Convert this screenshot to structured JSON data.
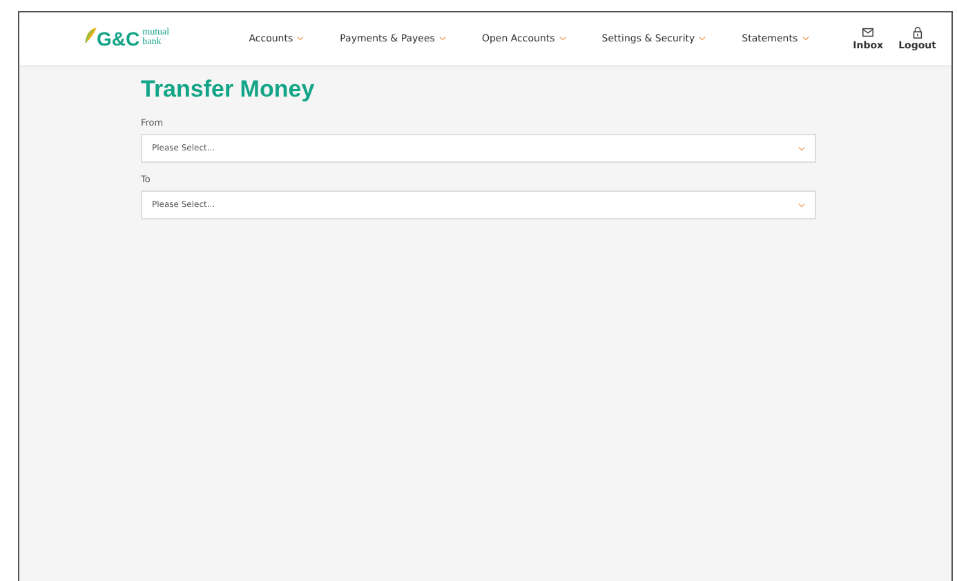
{
  "logo": {
    "mark": "G&C",
    "line_1": "mutual",
    "line_2": "bank"
  },
  "nav": [
    {
      "label": "Accounts"
    },
    {
      "label": "Payments & Payees"
    },
    {
      "label": "Open Accounts"
    },
    {
      "label": "Settings & Security"
    },
    {
      "label": "Statements"
    }
  ],
  "actions": [
    {
      "kind": "inbox",
      "label": "Inbox"
    },
    {
      "kind": "logout",
      "label": "Logout"
    }
  ],
  "page_title": "Transfer Money",
  "fields": [
    {
      "label": "From",
      "placeholder": "Please Select..."
    },
    {
      "label": "To",
      "placeholder": "Please Select..."
    }
  ]
}
